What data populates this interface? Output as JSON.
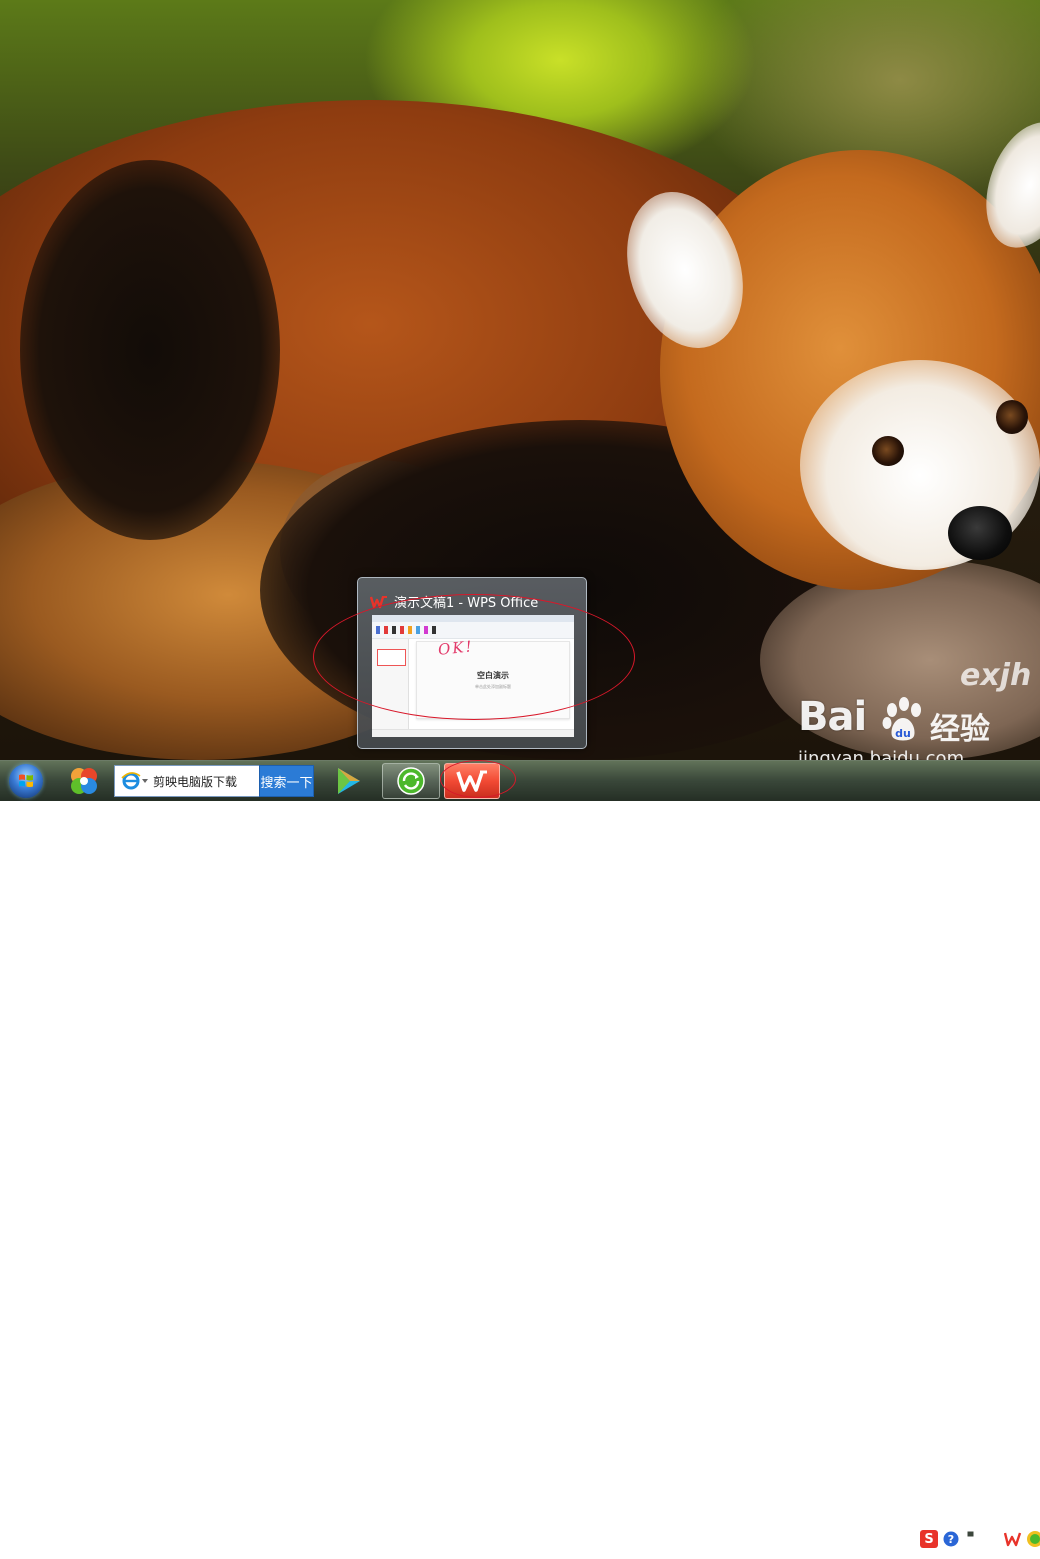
{
  "preview": {
    "title": "演示文稿1 - WPS Office",
    "thumbnail": {
      "main_text": "空白演示",
      "sub_text": "单击此处添加副标题",
      "annotation": "OK!"
    }
  },
  "taskbar": {
    "search_value": "剪映电脑版下载",
    "search_button": "搜索一下"
  },
  "watermark": {
    "brand_partial": "exjh",
    "logo": "Bai",
    "logo_paw_text": "du",
    "logo_suffix": "经验",
    "url": "jingyan.baidu.com"
  },
  "colors": {
    "annotation_red": "#d8182a",
    "wps_red": "#f24a34",
    "search_button_blue": "#2b7bd6"
  },
  "icons": [
    "windows-start-orb-icon",
    "pinwheel-app-icon",
    "ie-browser-icon",
    "play-video-app-icon",
    "green-refresh-app-icon",
    "wps-office-icon",
    "sogou-input-icon",
    "help-icon",
    "restore-window-icon",
    "show-hidden-icons-arrow-icon",
    "wps-tray-icon",
    "green-tray-icon"
  ]
}
